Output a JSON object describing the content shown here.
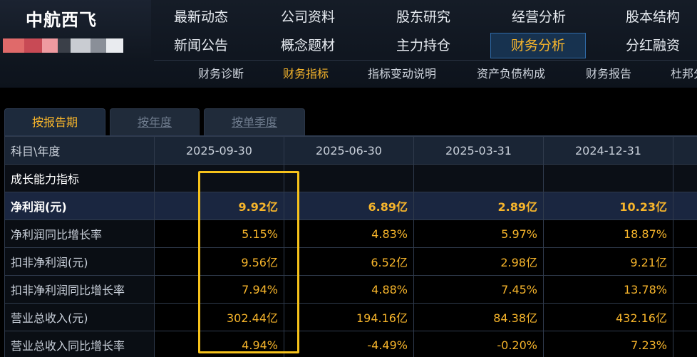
{
  "brand": {
    "name": "中航西飞"
  },
  "nav": {
    "row1": [
      "最新动态",
      "公司资料",
      "股东研究",
      "经营分析",
      "股本结构"
    ],
    "row2": [
      "新闻公告",
      "概念题材",
      "主力持仓",
      "财务分析",
      "分红融资"
    ],
    "active": "财务分析"
  },
  "subnav": {
    "items": [
      "财务诊断",
      "财务指标",
      "指标变动说明",
      "资产负债构成",
      "财务报告",
      "杜邦分"
    ],
    "active": "财务指标"
  },
  "tabs": {
    "items": [
      "按报告期",
      "按年度",
      "按单季度"
    ],
    "active": "按报告期"
  },
  "table": {
    "header_label": "科目\\年度",
    "columns": [
      "2025-09-30",
      "2025-06-30",
      "2025-03-31",
      "2024-12-31"
    ],
    "section_label": "成长能力指标",
    "rows": [
      {
        "label": "净利润(元)",
        "values": [
          "9.92亿",
          "6.89亿",
          "2.89亿",
          "10.23亿"
        ]
      },
      {
        "label": "净利润同比增长率",
        "values": [
          "5.15%",
          "4.83%",
          "5.97%",
          "18.87%"
        ]
      },
      {
        "label": "扣非净利润(元)",
        "values": [
          "9.56亿",
          "6.52亿",
          "2.98亿",
          "9.21亿"
        ]
      },
      {
        "label": "扣非净利润同比增长率",
        "values": [
          "7.94%",
          "4.88%",
          "7.45%",
          "13.78%"
        ]
      },
      {
        "label": "营业总收入(元)",
        "values": [
          "302.44亿",
          "194.16亿",
          "84.38亿",
          "432.16亿"
        ]
      },
      {
        "label": "营业总收入同比增长率",
        "values": [
          "4.94%",
          "-4.49%",
          "-0.20%",
          "7.23%"
        ]
      }
    ]
  },
  "colors": {
    "accent": "#f7b52b",
    "highlight_box": "#f6c21b",
    "active_nav_bg": "#17324f"
  }
}
